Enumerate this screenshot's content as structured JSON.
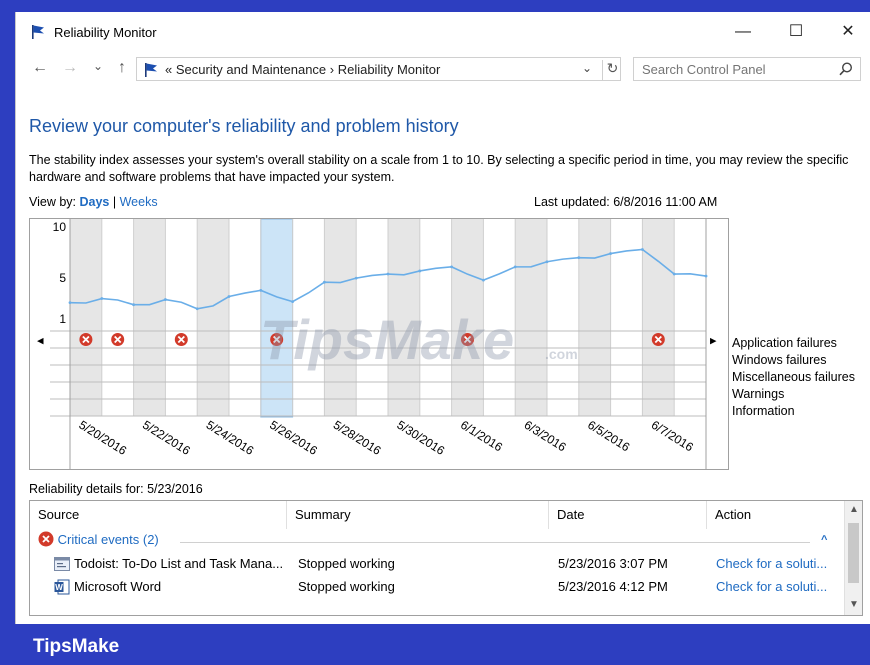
{
  "window": {
    "title": "Reliability Monitor",
    "minimize": "—",
    "maximize": "☐",
    "close": "✕"
  },
  "address": {
    "back": "←",
    "forward": "→",
    "recent": "⌄",
    "up": "↑",
    "path": "« Security and Maintenance  ›  Reliability Monitor",
    "dropdown": "⌄",
    "refresh": "↻"
  },
  "search": {
    "placeholder": "Search Control Panel"
  },
  "heading": "Review your computer's reliability and problem history",
  "description": "The stability index assesses your system's overall stability on a scale from 1 to 10. By selecting a specific period in time, you may review the specific hardware and software problems that have impacted your system.",
  "view_by": {
    "label": "View by:",
    "days": "Days",
    "separator": "|",
    "weeks": "Weeks"
  },
  "last_updated": "Last updated: 6/8/2016 11:00 AM",
  "chart": {
    "y_ticks": [
      "10",
      "5",
      "1"
    ],
    "left_arrow": "◂",
    "right_arrow": "▸",
    "watermark": "TipsMake",
    "watermark_suffix": ".com",
    "dates": [
      "5/20/2016",
      "5/22/2016",
      "5/24/2016",
      "5/26/2016",
      "5/28/2016",
      "5/30/2016",
      "6/1/2016",
      "6/3/2016",
      "6/5/2016",
      "6/7/2016"
    ],
    "categories": [
      "Application failures",
      "Windows failures",
      "Miscellaneous failures",
      "Warnings",
      "Information"
    ],
    "selected_column": 6,
    "error_columns": [
      1,
      2,
      4,
      7,
      13,
      19
    ],
    "line_color": "#6aaee8",
    "error_color": "#d23a2a"
  },
  "chart_data": {
    "type": "line",
    "x": [
      "5/19",
      "5/20",
      "5/21",
      "5/22",
      "5/23",
      "5/24",
      "5/25",
      "5/26",
      "5/27",
      "5/28",
      "5/29",
      "5/30",
      "5/31",
      "6/1",
      "6/2",
      "6/3",
      "6/4",
      "6/5",
      "6/6",
      "6/7",
      "6/8"
    ],
    "series": [
      {
        "values": [
          2.6,
          3.0,
          2.4,
          2.9,
          2.0,
          3.2,
          3.8,
          2.7,
          4.6,
          5.0,
          5.4,
          5.7,
          6.1,
          4.8,
          6.1,
          6.6,
          7.0,
          7.4,
          7.8,
          5.4,
          5.2
        ]
      }
    ],
    "ylim": [
      1,
      10
    ]
  },
  "details": {
    "label": "Reliability details for: 5/23/2016",
    "columns": [
      "Source",
      "Summary",
      "Date",
      "Action"
    ],
    "group": "Critical events (2)",
    "group_toggle": "^",
    "rows": [
      {
        "source": "Todoist: To-Do List and Task Mana...",
        "summary": "Stopped working",
        "date": "5/23/2016 3:07 PM",
        "action": "Check for a soluti..."
      },
      {
        "source": "Microsoft Word",
        "summary": "Stopped working",
        "date": "5/23/2016 4:12 PM",
        "action": "Check for a soluti..."
      }
    ]
  },
  "brand": "TipsMake"
}
